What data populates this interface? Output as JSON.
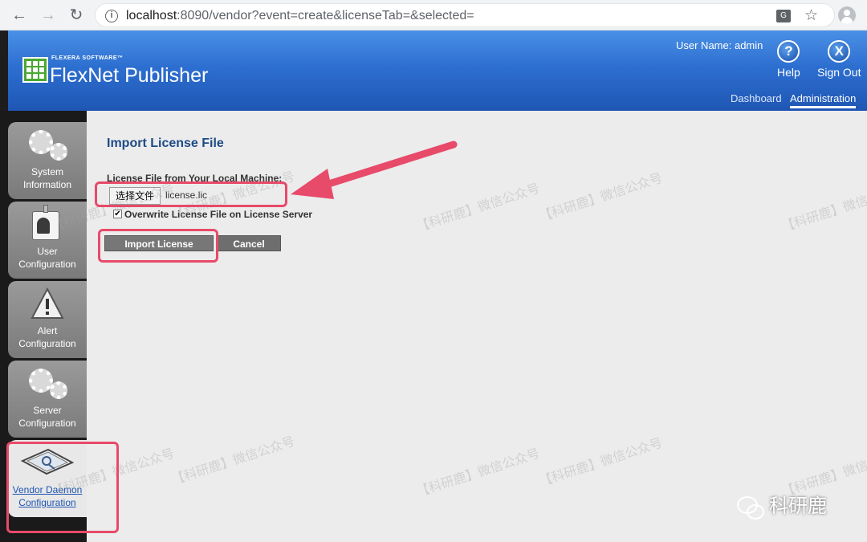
{
  "browser": {
    "url_host": "localhost",
    "url_rest": ":8090/vendor?event=create&licenseTab=&selected="
  },
  "header": {
    "logo_company": "FLEXERA SOFTWARE™",
    "logo_product": "FlexNet Publisher",
    "user_name": "User Name: admin",
    "help_label": "Help",
    "help_icon_glyph": "?",
    "signout_label": "Sign Out",
    "signout_icon_glyph": "X",
    "tabs": [
      {
        "label": "Dashboard",
        "active": false
      },
      {
        "label": "Administration",
        "active": true
      }
    ]
  },
  "sidebar": {
    "items": [
      {
        "label_line1": "System",
        "label_line2": "Information",
        "icon": "gears-icon",
        "active": false
      },
      {
        "label_line1": "User",
        "label_line2": "Configuration",
        "icon": "user-badge-icon",
        "active": false
      },
      {
        "label_line1": "Alert",
        "label_line2": "Configuration",
        "icon": "warning-icon",
        "active": false
      },
      {
        "label_line1": "Server",
        "label_line2": "Configuration",
        "icon": "gears-icon",
        "active": false
      },
      {
        "label_line1": "Vendor Daemon",
        "label_line2": "Configuration",
        "icon": "license-key-icon",
        "active": true
      }
    ]
  },
  "main": {
    "title": "Import License File",
    "field_label": "License File from Your Local Machine:",
    "file_button": "选择文件",
    "file_name": "license.lic",
    "overwrite_checked": true,
    "overwrite_label": "Overwrite License File on License Server",
    "import_button": "Import License",
    "cancel_button": "Cancel"
  },
  "annotations": {
    "highlight_color": "#e84a6a"
  },
  "watermark": {
    "text": "【科研鹿】微信公众号",
    "brand": "科研鹿"
  }
}
